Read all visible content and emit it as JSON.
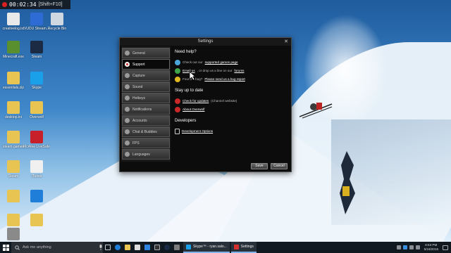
{
  "recording": {
    "time": "00:02:34",
    "hotkey": "[Shift+F10]"
  },
  "desktop_icons": [
    {
      "label": "creativelog.txt",
      "color": "#e9e9e9"
    },
    {
      "label": "VUDU Stream...",
      "color": "#2f6bd4"
    },
    {
      "label": "Recycle Bin",
      "color": "#cfd8e0"
    },
    {
      "label": "Minecraft.exe",
      "color": "#5a8f2f"
    },
    {
      "label": "Steam",
      "color": "#1b2b44"
    },
    {
      "label": "essentials.zip",
      "color": "#e8c453"
    },
    {
      "label": "Skype",
      "color": "#1aa0e8"
    },
    {
      "label": "desktop.ini",
      "color": "#e8c453"
    },
    {
      "label": "Overwolf",
      "color": "#e8c453"
    },
    {
      "label": "steam games",
      "color": "#e8c453"
    },
    {
      "label": "McAfee LiveSafe",
      "color": "#c8202a"
    },
    {
      "label": "Steam",
      "color": "#e8c453"
    },
    {
      "label": "iTunes",
      "color": "#f0f0f0"
    },
    {
      "label": "",
      "color": "#e8c453"
    },
    {
      "label": "",
      "color": "#1f7fd8"
    },
    {
      "label": "",
      "color": "#e8c453"
    },
    {
      "label": "",
      "color": "#e8c453"
    },
    {
      "label": "",
      "color": "#8a8a8a"
    }
  ],
  "dialog": {
    "title": "Settings",
    "close": "✕",
    "sidebar": [
      {
        "label": "General",
        "active": false
      },
      {
        "label": "Support",
        "active": true
      },
      {
        "label": "Capture",
        "active": false
      },
      {
        "label": "Sound",
        "active": false
      },
      {
        "label": "Hotkeys",
        "active": false
      },
      {
        "label": "Notifications",
        "active": false
      },
      {
        "label": "Accounts",
        "active": false
      },
      {
        "label": "Chat & Buddies",
        "active": false
      },
      {
        "label": "FPS",
        "active": false
      },
      {
        "label": "Languages",
        "active": false
      }
    ],
    "help": {
      "title": "Need help?",
      "row1_prefix": "Check out our",
      "row1_link": "supported games page",
      "row2_link": "Email us",
      "row2_mid": ", or drop us a line on our",
      "row2_link2": "forums",
      "row3_prefix": "Found a bug?",
      "row3_link": "Please send us a bug report"
    },
    "updates": {
      "title": "Stay up to date",
      "row1_link": "Check for updates",
      "row1_suffix": "(Channel website)",
      "row2_link": "About Overwolf"
    },
    "developers": {
      "title": "Developers",
      "row1_link": "Development Options"
    },
    "buttons": {
      "save": "Save",
      "cancel": "Cancel"
    }
  },
  "taskbar": {
    "search_placeholder": "Ask me anything",
    "apps": [
      {
        "label": "Skype™ - ryan.salo...",
        "color": "#1aa0e8"
      },
      {
        "label": "Settings",
        "color": "#d53030"
      }
    ],
    "time": "6:53 PM",
    "date": "5/18/2016"
  },
  "colors": {
    "accent": "#7eb4ea",
    "support_red": "#d53030",
    "dialog_bg": "#0c0c0c"
  }
}
